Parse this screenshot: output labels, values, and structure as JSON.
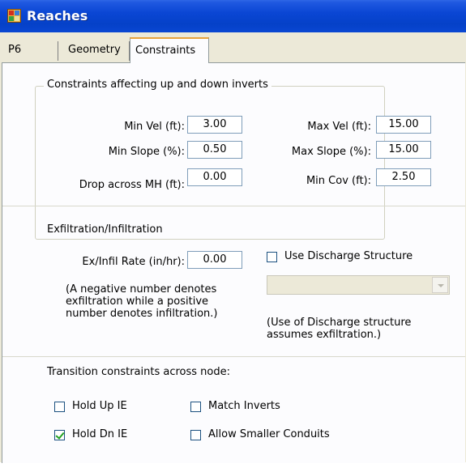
{
  "window": {
    "title": "Reaches",
    "icon": "app-grid-icon"
  },
  "tabs": [
    {
      "label": "P6",
      "selected": false
    },
    {
      "label": "Geometry",
      "selected": false
    },
    {
      "label": "Constraints",
      "selected": true
    }
  ],
  "inverts_group": {
    "title": "Constraints affecting up and down inverts",
    "min_vel": {
      "label": "Min Vel (ft):",
      "value": "3.00"
    },
    "max_vel": {
      "label": "Max Vel (ft):",
      "value": "15.00"
    },
    "min_slope": {
      "label": "Min Slope (%):",
      "value": "0.50"
    },
    "max_slope": {
      "label": "Max Slope (%):",
      "value": "15.00"
    },
    "drop_mh": {
      "label": "Drop across MH (ft):",
      "value": "0.00"
    },
    "min_cov": {
      "label": "Min Cov (ft):",
      "value": "2.50"
    }
  },
  "exfil_group": {
    "title": "Exfiltration/Infiltration",
    "rate": {
      "label": "Ex/Infil Rate (in/hr):",
      "value": "0.00"
    },
    "note_lines": [
      "(A negative number denotes",
      "exfiltration while a positive",
      "number denotes infiltration.)"
    ],
    "use_discharge": {
      "label": "Use Discharge Structure",
      "checked": false
    },
    "discharge_select": {
      "value": ""
    },
    "discharge_note_lines": [
      "(Use of Discharge structure",
      "assumes exfiltration.)"
    ]
  },
  "transition_group": {
    "title": "Transition constraints across node:",
    "hold_up_ie": {
      "label": "Hold Up IE",
      "checked": false
    },
    "match_inverts": {
      "label": "Match Inverts",
      "checked": false
    },
    "hold_dn_ie": {
      "label": "Hold Dn IE",
      "checked": true
    },
    "allow_smaller": {
      "label": "Allow Smaller Conduits",
      "checked": false
    }
  },
  "colors": {
    "titlebar": "#0a46d4",
    "window_bg": "#ece9d8",
    "page_bg": "#fcfcfe",
    "tab_highlight": "#e6a23c",
    "check_mark": "#21a121"
  }
}
